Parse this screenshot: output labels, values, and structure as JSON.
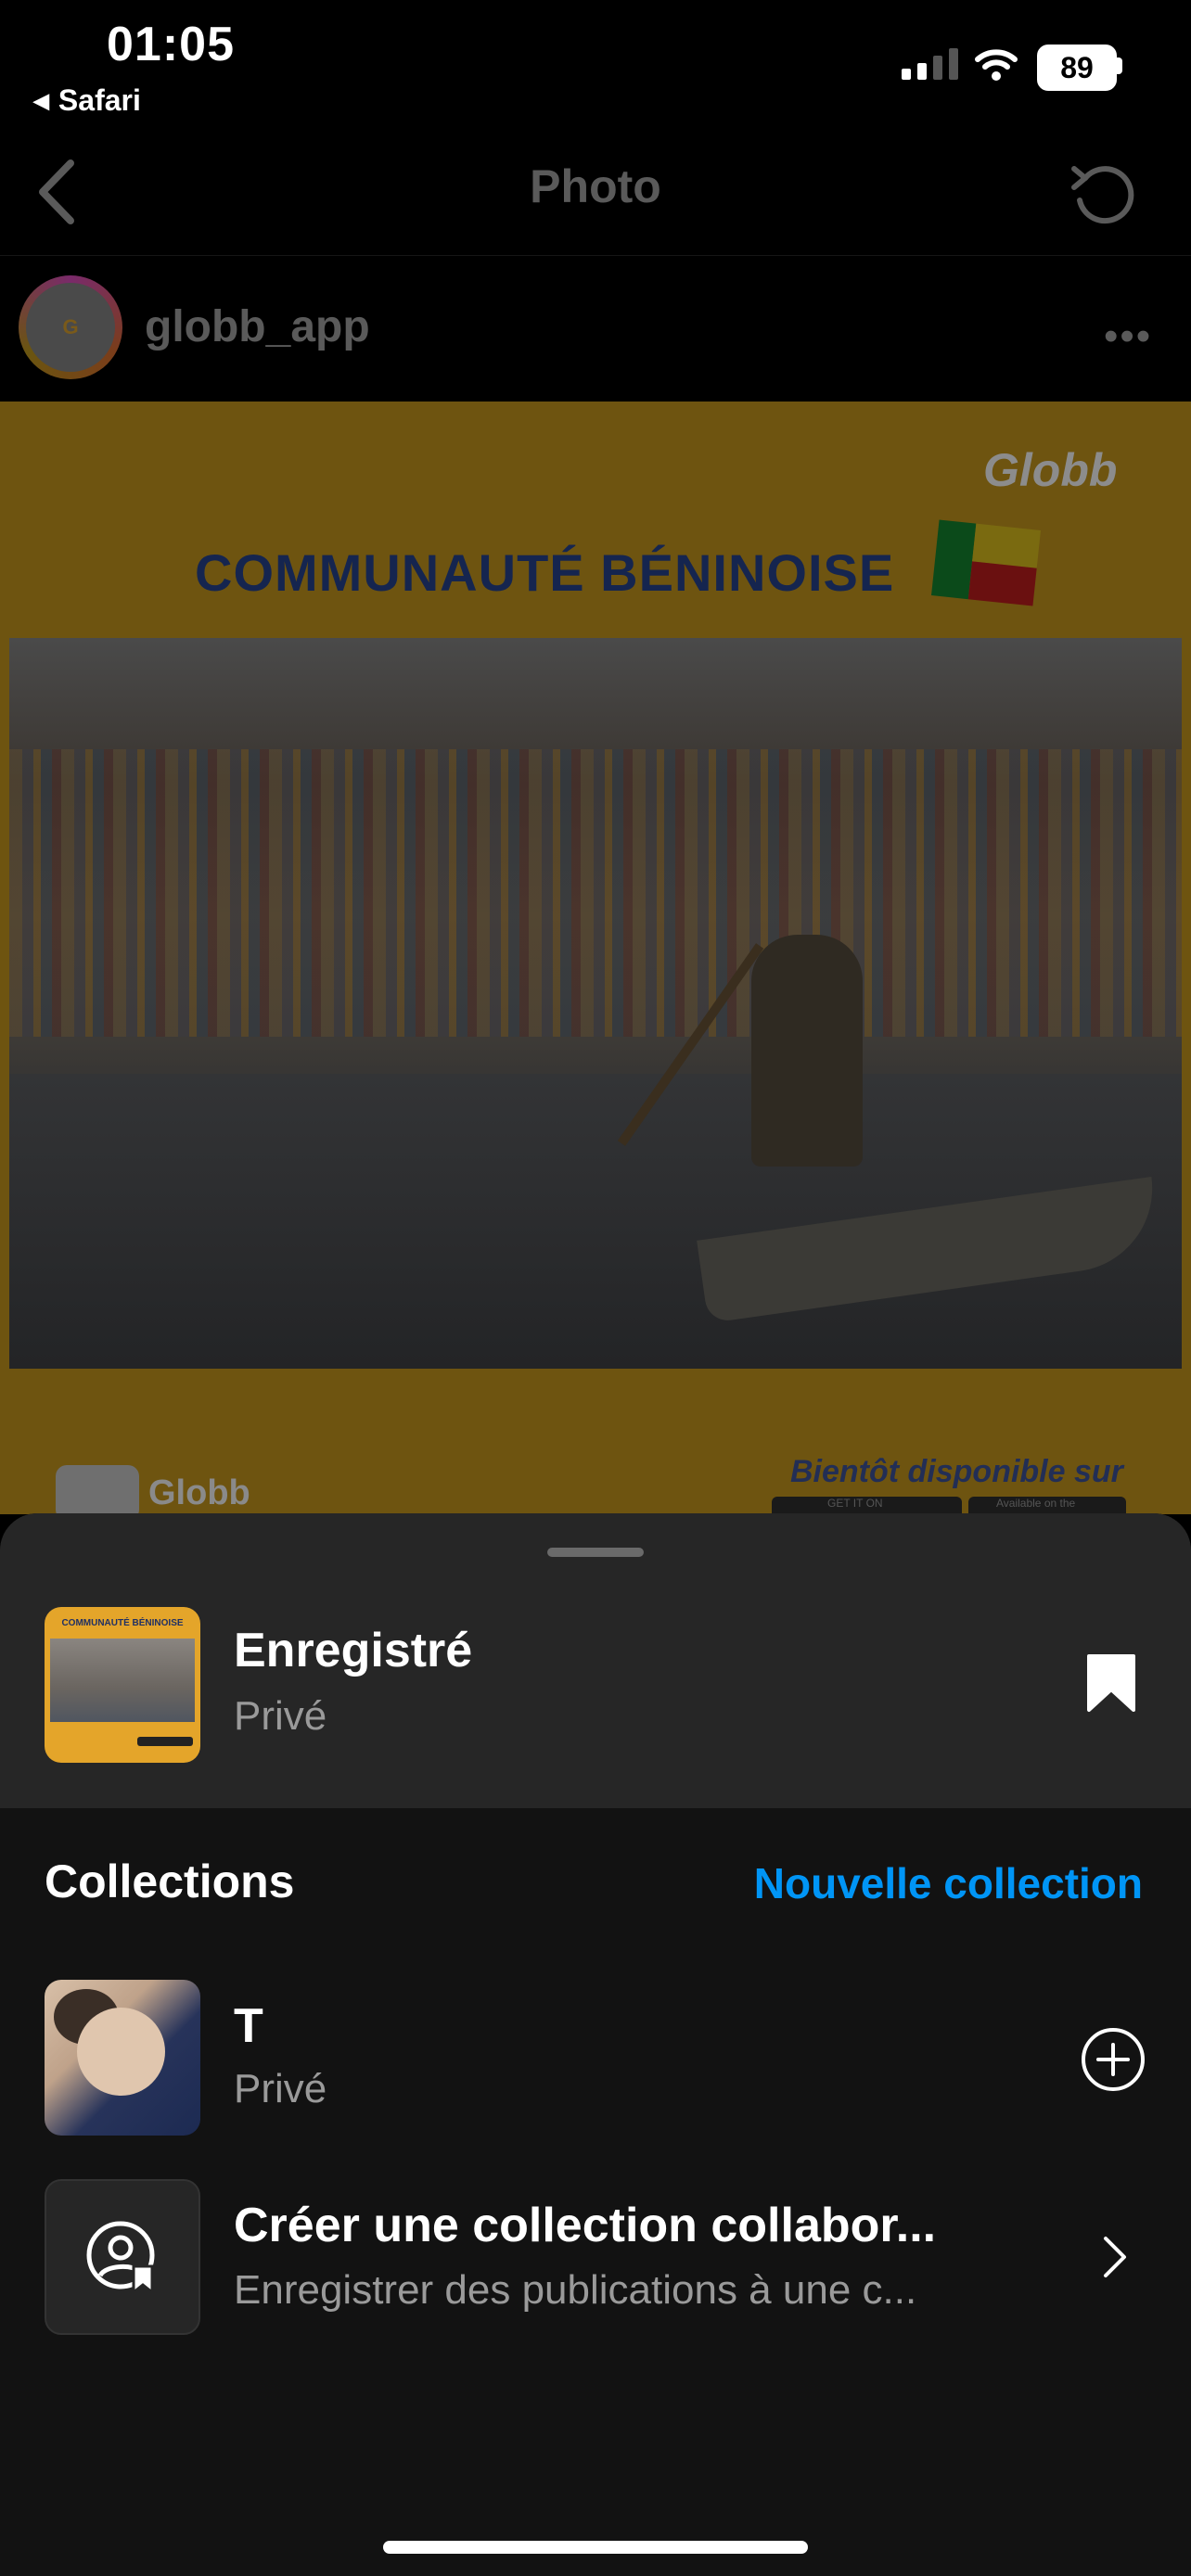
{
  "status_bar": {
    "time": "01:05",
    "back_app": "Safari",
    "battery": "89"
  },
  "header": {
    "title": "Photo"
  },
  "post": {
    "username": "globb_app",
    "more": "•••",
    "logo": "Globb",
    "headline": "COMMUNAUTÉ BÉNINOISE",
    "footer_logo": "Globb",
    "availability": "Bientôt disponible sur",
    "store_google": "GET IT ON",
    "store_apple": "Available on the"
  },
  "sheet": {
    "saved": {
      "title": "Enregistré",
      "subtitle": "Privé"
    },
    "collections_header": "Collections",
    "new_collection": "Nouvelle collection",
    "collections": [
      {
        "name": "T",
        "privacy": "Privé"
      }
    ],
    "collab": {
      "title": "Créer une collection collabor...",
      "subtitle": "Enregistrer des publications à une c..."
    }
  },
  "colors": {
    "accent": "#0095f6",
    "sheet_bg": "#121212",
    "saved_row_bg": "#262626"
  }
}
